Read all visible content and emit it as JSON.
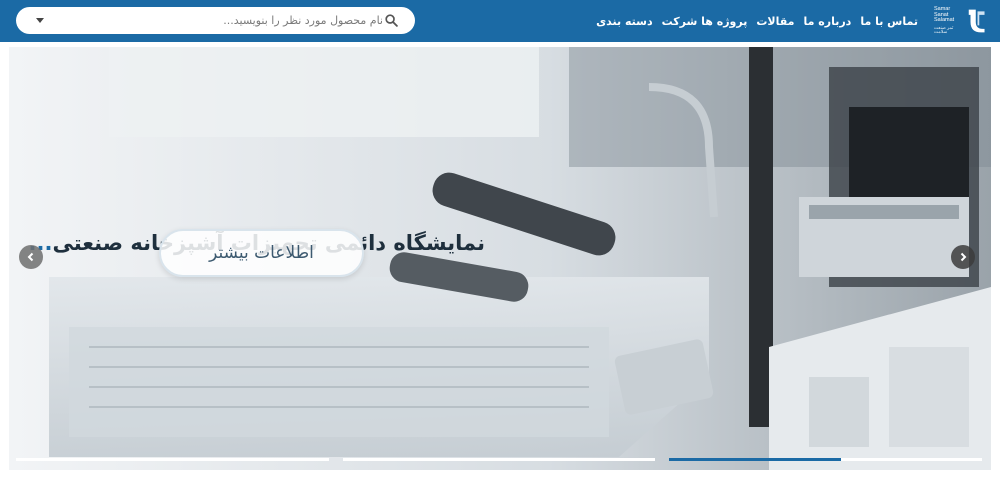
{
  "header": {
    "logo": {
      "line1": "Samar",
      "line2": "Sanat",
      "line3": "Salamat",
      "tagline": "ثمر صنعت سلامت"
    },
    "nav": [
      {
        "label": "دسته بندی"
      },
      {
        "label": "پروژه ها شرکت"
      },
      {
        "label": "مقالات"
      },
      {
        "label": "درباره ما"
      },
      {
        "label": "تماس با ما"
      }
    ],
    "search": {
      "placeholder": "نام محصول مورد نظر را بنویسید..."
    }
  },
  "hero": {
    "title_main": "نمایشگاه دائمی تجهیزات آشپزخانه صنعتی",
    "title_suffix": "...",
    "button_label": "اطلاعات بیشتر",
    "slides": [
      {
        "progress": 1.0
      },
      {
        "progress": 1.0
      },
      {
        "progress": 0.55
      }
    ]
  },
  "colors": {
    "brand": "#1b6aa5",
    "title_dark": "#1e2f3d",
    "progress_active": "#1b6aa5",
    "progress_track": "#ffffff"
  },
  "icons": {
    "search": "search-icon",
    "dropdown": "chevron-down-icon",
    "prev": "chevron-left-icon",
    "next": "chevron-right-icon"
  }
}
